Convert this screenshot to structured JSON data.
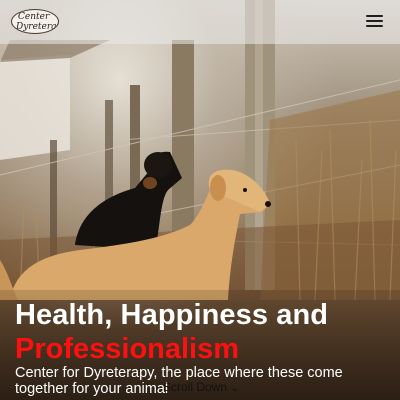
{
  "header": {
    "logo_line1": "Center",
    "logo_line2": "Dyreterapi",
    "menu_icon": "hamburger-menu-icon"
  },
  "hero": {
    "headline_line1": "Health, Happiness and",
    "headline_line2": "Professionalism",
    "subtitle": "Center for Dyreterapy, the place where these come together for your animal",
    "scroll_label": "Scroll Down",
    "scroll_icon": "double-chevron-down-icon"
  },
  "colors": {
    "highlight": "#ff1010",
    "headline": "#ffffff",
    "header_bg": "rgba(235,235,235,0.55)"
  }
}
